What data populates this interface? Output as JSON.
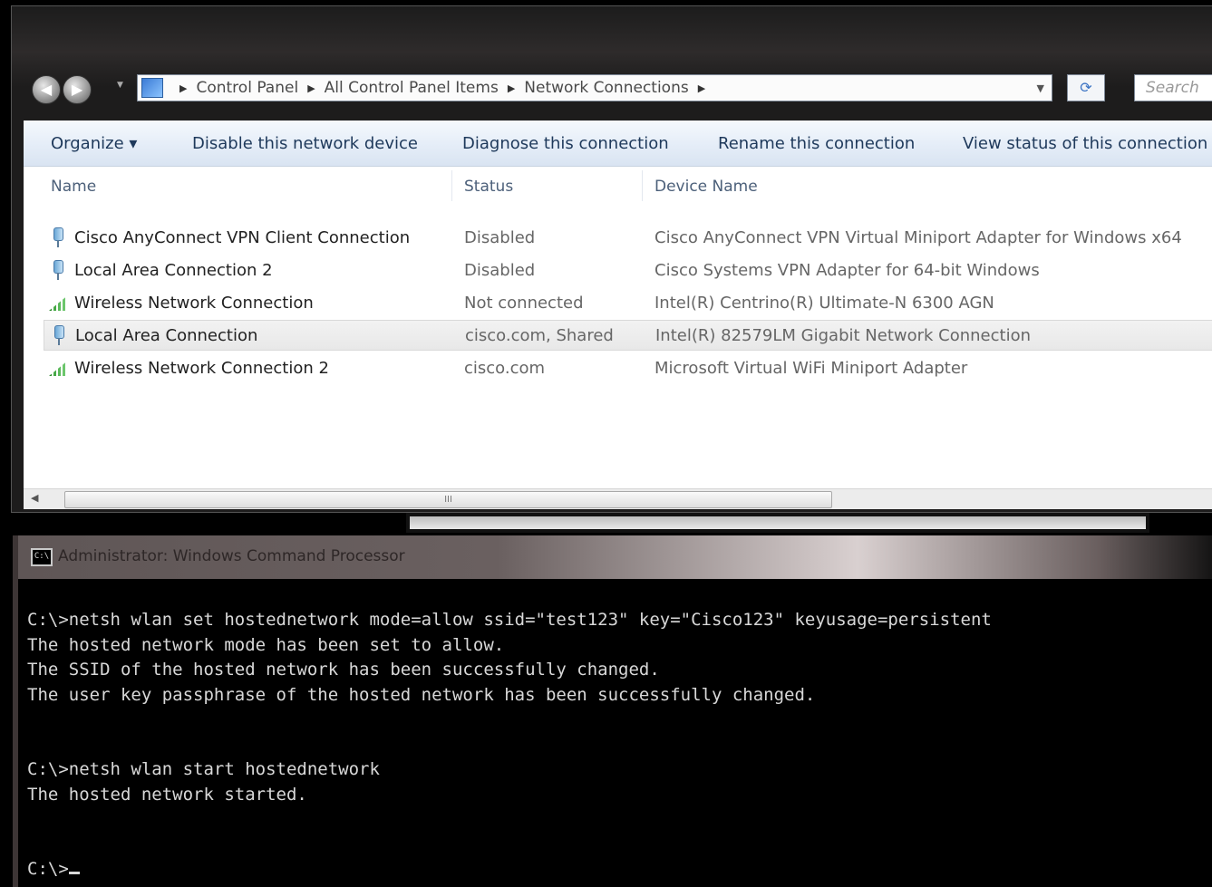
{
  "explorer": {
    "breadcrumbs": [
      "Control Panel",
      "All Control Panel Items",
      "Network Connections"
    ],
    "search_placeholder": "Search",
    "commands": {
      "organize": "Organize ▾",
      "disable": "Disable this network device",
      "diagnose": "Diagnose this connection",
      "rename": "Rename this connection",
      "view_status": "View status of this connection"
    },
    "columns": {
      "name": "Name",
      "status": "Status",
      "device": "Device Name"
    },
    "connections": [
      {
        "name": "Cisco AnyConnect VPN Client Connection",
        "status": "Disabled",
        "device": "Cisco AnyConnect VPN Virtual Miniport Adapter for Windows x64",
        "icon": "wired-adapter-icon"
      },
      {
        "name": "Local Area Connection 2",
        "status": "Disabled",
        "device": "Cisco Systems VPN Adapter for 64-bit Windows",
        "icon": "wired-adapter-icon"
      },
      {
        "name": "Wireless Network Connection",
        "status": "Not connected",
        "device": "Intel(R) Centrino(R) Ultimate-N 6300 AGN",
        "icon": "wireless-signal-icon"
      },
      {
        "name": "Local Area Connection",
        "status": "cisco.com, Shared",
        "device": "Intel(R) 82579LM Gigabit Network Connection",
        "icon": "wired-adapter-icon",
        "selected": true
      },
      {
        "name": "Wireless Network Connection 2",
        "status": "cisco.com",
        "device": "Microsoft Virtual WiFi Miniport Adapter",
        "icon": "wireless-signal-icon"
      }
    ],
    "scroll_grip": "III"
  },
  "console": {
    "title": "Administrator: Windows Command Processor",
    "lines": [
      "C:\\>netsh wlan set hostednetwork mode=allow ssid=\"test123\" key=\"Cisco123\" keyusage=persistent",
      "The hosted network mode has been set to allow.",
      "The SSID of the hosted network has been successfully changed.",
      "The user key passphrase of the hosted network has been successfully changed.",
      "",
      "",
      "C:\\>netsh wlan start hostednetwork",
      "The hosted network started.",
      "",
      "",
      "C:\\>"
    ]
  }
}
